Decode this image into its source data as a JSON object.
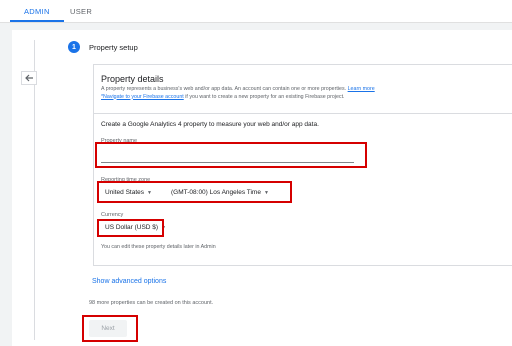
{
  "tabs": [
    {
      "label": "ADMIN",
      "active": true
    },
    {
      "label": "USER",
      "active": false
    }
  ],
  "step": {
    "number": "1",
    "title": "Property setup"
  },
  "details": {
    "title": "Property details",
    "desc_text": "A property represents a business's web and/or app data. An account can contain one or more properties.",
    "learn_more": "Learn more",
    "firebase_link": "*Navigate to your Firebase account",
    "desc_tail": "if you want to create a new property for an existing Firebase project."
  },
  "form": {
    "intro": "Create a Google Analytics 4 property to measure your web and/or app data.",
    "property_name_label": "Property name",
    "property_name_value": "",
    "timezone_label": "Reporting time zone",
    "timezone_country": "United States",
    "timezone_zone": "(GMT-08:00) Los Angeles Time",
    "currency_label": "Currency",
    "currency_value": "US Dollar (USD $)",
    "edit_note": "You can edit these property details later in Admin"
  },
  "advanced_link": "Show advanced options",
  "remaining_text": "98 more properties can be created on this account.",
  "next_label": "Next",
  "colors": {
    "accent": "#1a73e8",
    "highlight": "#d50000"
  },
  "icons": {
    "back": "arrow-left-icon",
    "caret": "caret-down-icon"
  }
}
